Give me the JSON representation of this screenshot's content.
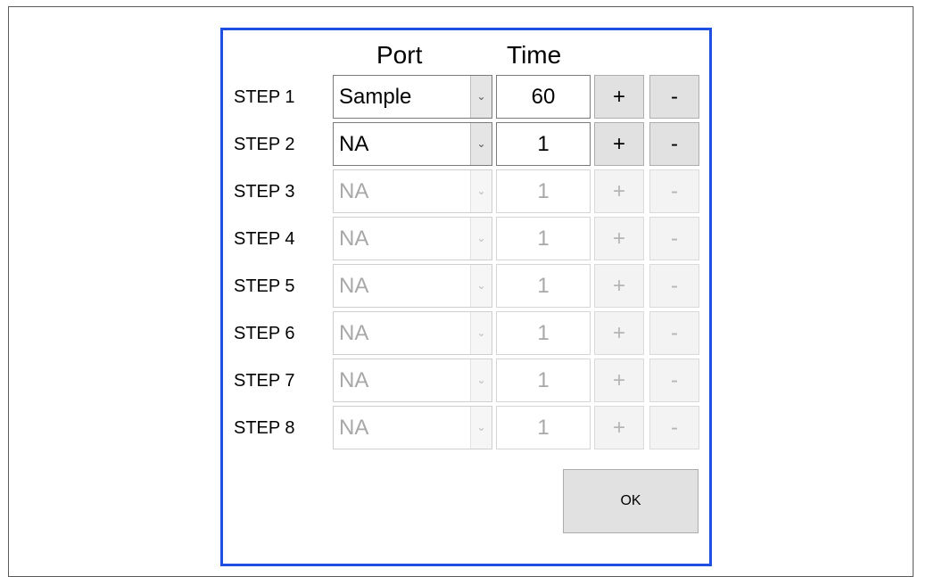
{
  "header": {
    "port": "Port",
    "time": "Time"
  },
  "buttons": {
    "plus": "+",
    "minus": "-",
    "ok": "OK"
  },
  "steps": [
    {
      "label": "STEP 1",
      "port": "Sample",
      "time": "60",
      "enabled": true
    },
    {
      "label": "STEP 2",
      "port": "NA",
      "time": "1",
      "enabled": true
    },
    {
      "label": "STEP 3",
      "port": "NA",
      "time": "1",
      "enabled": false
    },
    {
      "label": "STEP 4",
      "port": "NA",
      "time": "1",
      "enabled": false
    },
    {
      "label": "STEP 5",
      "port": "NA",
      "time": "1",
      "enabled": false
    },
    {
      "label": "STEP 6",
      "port": "NA",
      "time": "1",
      "enabled": false
    },
    {
      "label": "STEP 7",
      "port": "NA",
      "time": "1",
      "enabled": false
    },
    {
      "label": "STEP 8",
      "port": "NA",
      "time": "1",
      "enabled": false
    }
  ],
  "colors": {
    "dialog_border": "#1f4fe0",
    "button_bg": "#e1e1e1",
    "disabled_text": "#a8a8a8"
  }
}
